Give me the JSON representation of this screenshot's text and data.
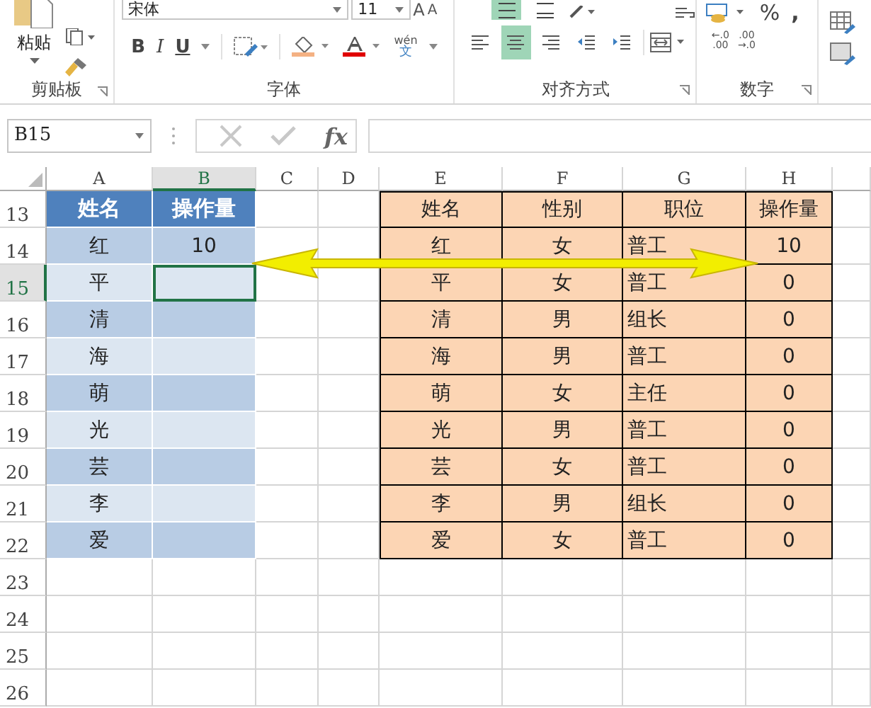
{
  "ribbon": {
    "clipboard": {
      "paste_label": "粘贴",
      "label": "剪贴板"
    },
    "font": {
      "label": "字体",
      "font_name": "宋体",
      "font_size": "11",
      "grow": "A",
      "shrink": "A",
      "bold": "B",
      "italic": "I",
      "underline": "U",
      "phonetic": "wén",
      "phonetic_char": "文"
    },
    "alignment": {
      "label": "对齐方式",
      "top_buttons": [
        {
          "kind": "middle",
          "selected": true
        },
        {
          "kind": "bottom",
          "selected": false
        }
      ],
      "buttons": [
        {
          "kind": "left",
          "selected": false
        },
        {
          "kind": "center",
          "selected": true
        },
        {
          "kind": "right",
          "selected": false
        },
        {
          "kind": "outdent",
          "selected": false
        },
        {
          "kind": "indent",
          "selected": false
        }
      ]
    },
    "number": {
      "label": "数字",
      "percent": "%",
      "comma": ",",
      "increase_decimal": [
        "←.0",
        ".00"
      ],
      "decrease_decimal": [
        ".00",
        "→.0"
      ]
    }
  },
  "formula_bar": {
    "name_box": "B15",
    "fx": "fx"
  },
  "sheet": {
    "columns": [
      {
        "label": "A",
        "selected": false
      },
      {
        "label": "B",
        "selected": true
      },
      {
        "label": "C",
        "selected": false
      },
      {
        "label": "D",
        "selected": false
      },
      {
        "label": "E",
        "selected": false
      },
      {
        "label": "F",
        "selected": false
      },
      {
        "label": "G",
        "selected": false
      },
      {
        "label": "H",
        "selected": false
      }
    ],
    "rows": [
      {
        "label": "13",
        "selected": false
      },
      {
        "label": "14",
        "selected": false
      },
      {
        "label": "15",
        "selected": true
      },
      {
        "label": "16",
        "selected": false
      },
      {
        "label": "17",
        "selected": false
      },
      {
        "label": "18",
        "selected": false
      },
      {
        "label": "19",
        "selected": false
      },
      {
        "label": "20",
        "selected": false
      },
      {
        "label": "21",
        "selected": false
      },
      {
        "label": "22",
        "selected": false
      },
      {
        "label": "23",
        "selected": false
      },
      {
        "label": "24",
        "selected": false
      },
      {
        "label": "25",
        "selected": false
      },
      {
        "label": "26",
        "selected": false
      }
    ],
    "left_table": {
      "columns": [
        "姓名",
        "操作量"
      ],
      "rows": [
        {
          "name": "红",
          "value": "10",
          "selected": false
        },
        {
          "name": "平",
          "selected": true
        },
        {
          "name": "清",
          "selected": false
        },
        {
          "name": "海",
          "selected": false
        },
        {
          "name": "萌",
          "selected": false
        },
        {
          "name": "光",
          "selected": false
        },
        {
          "name": "芸",
          "selected": false
        },
        {
          "name": "李",
          "selected": false
        },
        {
          "name": "爱",
          "selected": false
        }
      ]
    },
    "right_table": {
      "columns": [
        "姓名",
        "性别",
        "职位",
        "操作量"
      ],
      "rows": [
        [
          "红",
          "女",
          "普工",
          "10"
        ],
        [
          "平",
          "女",
          "普工",
          "0"
        ],
        [
          "清",
          "男",
          "组长",
          "0"
        ],
        [
          "海",
          "男",
          "普工",
          "0"
        ],
        [
          "萌",
          "女",
          "主任",
          "0"
        ],
        [
          "光",
          "男",
          "普工",
          "0"
        ],
        [
          "芸",
          "女",
          "普工",
          "0"
        ],
        [
          "李",
          "男",
          "组长",
          "0"
        ],
        [
          "爱",
          "女",
          "普工",
          "0"
        ]
      ]
    }
  }
}
